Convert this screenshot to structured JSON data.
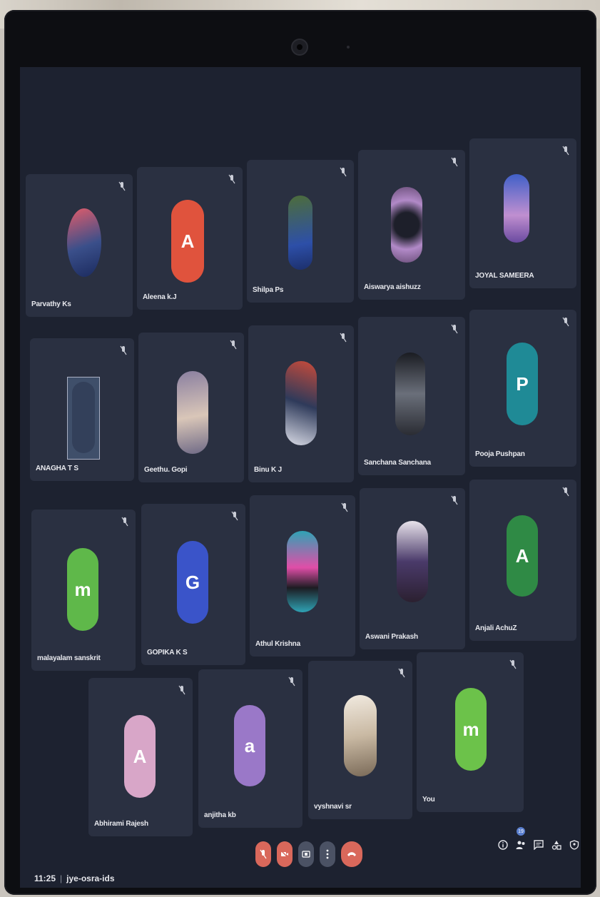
{
  "meeting": {
    "time": "11:25",
    "separator": "|",
    "code": "jye-osra-ids"
  },
  "participants": [
    {
      "name": "Parvathy Ks",
      "avatar": "photo",
      "color": "#3a4f8a"
    },
    {
      "name": "Aleena k.J",
      "avatar": "letter",
      "letter": "A",
      "color": "#e0533d"
    },
    {
      "name": "Shilpa Ps",
      "avatar": "photo",
      "color": "#4d6d3a"
    },
    {
      "name": "Aiswarya aishuzz",
      "avatar": "photo",
      "color": "#6b4f7a"
    },
    {
      "name": "JOYAL SAMEERA",
      "avatar": "photo",
      "color": "#5a3f8a"
    },
    {
      "name": "ANAGHA T S",
      "avatar": "photo",
      "color": "#3f4f6a"
    },
    {
      "name": "Geethu. Gopi",
      "avatar": "photo",
      "color": "#8a7fa0"
    },
    {
      "name": "Binu K J",
      "avatar": "photo",
      "color": "#2e3a5a"
    },
    {
      "name": "Sanchana Sanchana",
      "avatar": "photo",
      "color": "#3a3f4a"
    },
    {
      "name": "Pooja Pushpan",
      "avatar": "letter",
      "letter": "P",
      "color": "#1f8a96"
    },
    {
      "name": "malayalam sanskrit",
      "avatar": "letter",
      "letter": "m",
      "color": "#5fb84a"
    },
    {
      "name": "GOPIKA K S",
      "avatar": "letter",
      "letter": "G",
      "color": "#3a54c9"
    },
    {
      "name": "Athul Krishna",
      "avatar": "photo",
      "color": "#2fa3b5"
    },
    {
      "name": "Aswani Prakash",
      "avatar": "photo",
      "color": "#4a3a6a"
    },
    {
      "name": "Anjali AchuZ",
      "avatar": "letter",
      "letter": "A",
      "color": "#2f8a45"
    },
    {
      "name": "Abhirami Rajesh",
      "avatar": "letter",
      "letter": "A",
      "color": "#d8a6c8"
    },
    {
      "name": "anjitha kb",
      "avatar": "letter",
      "letter": "a",
      "color": "#9a78c8"
    },
    {
      "name": "vyshnavi sr",
      "avatar": "photo",
      "color": "#c9b9a3"
    },
    {
      "name": "You",
      "avatar": "letter",
      "letter": "m",
      "color": "#6cc24a"
    }
  ],
  "controls": {
    "mic_icon": "mic-off-icon",
    "camera_icon": "camera-off-icon",
    "present_icon": "present-screen-icon",
    "more_icon": "more-options-icon",
    "leave_icon": "leave-call-icon"
  },
  "right_panel": {
    "participant_count": "19",
    "icons": [
      "info-icon",
      "people-icon",
      "chat-icon",
      "activities-icon",
      "host-controls-icon"
    ]
  }
}
